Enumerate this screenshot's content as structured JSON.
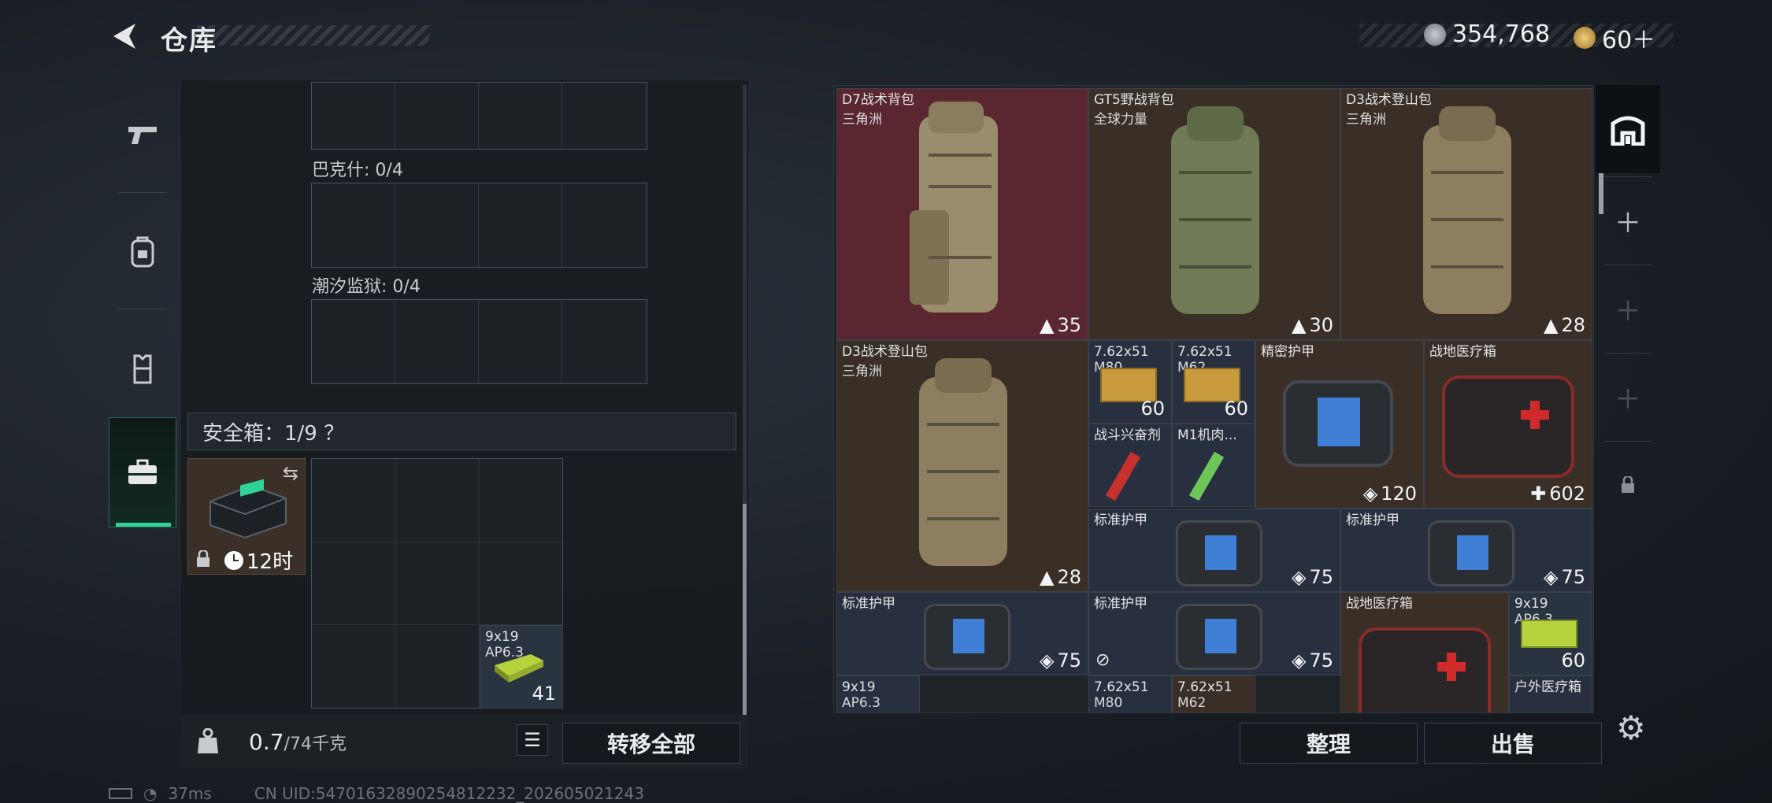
{
  "header": {
    "title": "仓库",
    "coins": "354,768",
    "tokens": "60＋"
  },
  "sidebar": {
    "tabs": [
      "weapon",
      "backpack",
      "armor-vest",
      "safe-box"
    ]
  },
  "left": {
    "containers": [
      {
        "label": "巴克什: 0/4"
      },
      {
        "label": "潮汐监狱: 0/4"
      }
    ],
    "safe": {
      "label": "安全箱：1/9 ？",
      "timer": "12时"
    },
    "ammo": {
      "name": "9x19",
      "sub": "AP6.3",
      "qty": "41"
    },
    "weight": {
      "value": "0.7",
      "total": "/74千克"
    },
    "transfer_all": "转移全部"
  },
  "right": {
    "items": [
      {
        "name": "D7战术背包",
        "sub": "三角洲",
        "qty": "35"
      },
      {
        "name": "GT5野战背包",
        "sub": "全球力量",
        "qty": "30"
      },
      {
        "name": "D3战术登山包",
        "sub": "三角洲",
        "qty": "28"
      },
      {
        "name": "D3战术登山包",
        "sub": "三角洲",
        "qty": "28"
      },
      {
        "name": "7.62x51",
        "sub": "M80",
        "qty": "60"
      },
      {
        "name": "7.62x51",
        "sub": "M62",
        "qty": "60"
      },
      {
        "name": "精密护甲",
        "sub": "",
        "qty": "120"
      },
      {
        "name": "战地医疗箱",
        "sub": "",
        "qty": "602"
      },
      {
        "name": "战斗兴奋剂",
        "sub": "",
        "qty": ""
      },
      {
        "name": "M1机肉...",
        "sub": "",
        "qty": ""
      },
      {
        "name": "标准护甲",
        "sub": "",
        "qty": "75"
      },
      {
        "name": "标准护甲",
        "sub": "",
        "qty": "75"
      },
      {
        "name": "标准护甲",
        "sub": "",
        "qty": "75"
      },
      {
        "name": "标准护甲",
        "sub": "",
        "qty": "75"
      },
      {
        "name": "战地医疗箱",
        "sub": "",
        "qty": ""
      },
      {
        "name": "9x19",
        "sub": "AP6.3",
        "qty": "60"
      },
      {
        "name": "9x19",
        "sub": "AP6.3",
        "qty": ""
      },
      {
        "name": "7.62x51",
        "sub": "M80",
        "qty": ""
      },
      {
        "name": "7.62x51",
        "sub": "M62",
        "qty": ""
      },
      {
        "name": "户外医疗箱",
        "sub": "",
        "qty": ""
      }
    ],
    "sort": "整理",
    "sell": "出售"
  },
  "status": {
    "ping": "37ms",
    "uid": "CN UID:54701632890254812232_202605021243"
  },
  "colors": {
    "backpack_red": "#5a2630",
    "item_brown": "#3a2f26",
    "item_blue": "#28303f",
    "accent_green": "#2fd39a"
  }
}
